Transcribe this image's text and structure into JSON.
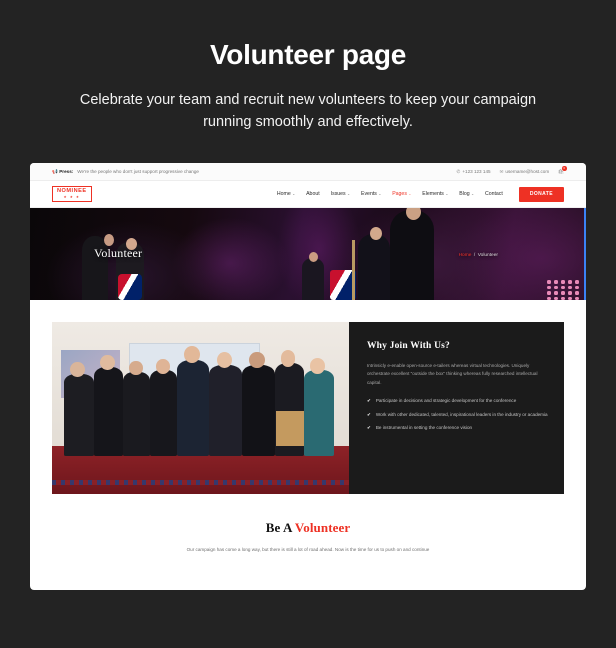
{
  "promo": {
    "title": "Volunteer page",
    "subtitle": "Celebrate your team and recruit new volunteers to keep your campaign running smoothly and effectively."
  },
  "site": {
    "topbar": {
      "press_label": "Press:",
      "press_text": "We're the people who don't just support progressive change",
      "phone_icon": "phone-icon",
      "phone": "+123 123 145",
      "email_icon": "envelope-icon",
      "email": "username@host.com",
      "cart_icon": "shopping-bag-icon",
      "cart_count": "0"
    },
    "nav": {
      "logo_text": "NOMINEE",
      "logo_stars": "★ ★ ★",
      "items": [
        {
          "label": "Home",
          "caret": "⌄",
          "active": false
        },
        {
          "label": "About",
          "caret": "",
          "active": false
        },
        {
          "label": "Issues",
          "caret": "⌄",
          "active": false
        },
        {
          "label": "Events",
          "caret": "⌄",
          "active": false
        },
        {
          "label": "Pages",
          "caret": "⌄",
          "active": true
        },
        {
          "label": "Elements",
          "caret": "⌄",
          "active": false
        },
        {
          "label": "Blog",
          "caret": "⌄",
          "active": false
        },
        {
          "label": "Contact",
          "caret": "",
          "active": false
        }
      ],
      "donate_label": "DONATE"
    },
    "hero": {
      "title": "Volunteer",
      "crumb_home": "Home",
      "crumb_sep": "/",
      "crumb_current": "Volunteer"
    },
    "join": {
      "heading": "Why Join With Us?",
      "paragraph": "Intrinsicly e-enable open-source e-tailers whereas virtual technologies. Uniquely orchestrate excellent \"outside the box\" thinking whereas fully researched intellectual capital.",
      "check_icon": "✔",
      "bullets": [
        "Participate in decisions and strategic development for the conference",
        "Work with other dedicated, talented, inspirational leaders in the industry or academia",
        "Be instrumental in setting the conference vision"
      ]
    },
    "cta": {
      "heading_plain": "Be A ",
      "heading_accent": "Volunteer",
      "paragraph": "Our campaign has come a long way, but there is still a lot of road ahead. Now is the time for us to push on and continue"
    }
  },
  "colors": {
    "page_bg": "#232323",
    "accent": "#ee3124",
    "dark_panel": "#1b1b1b"
  }
}
